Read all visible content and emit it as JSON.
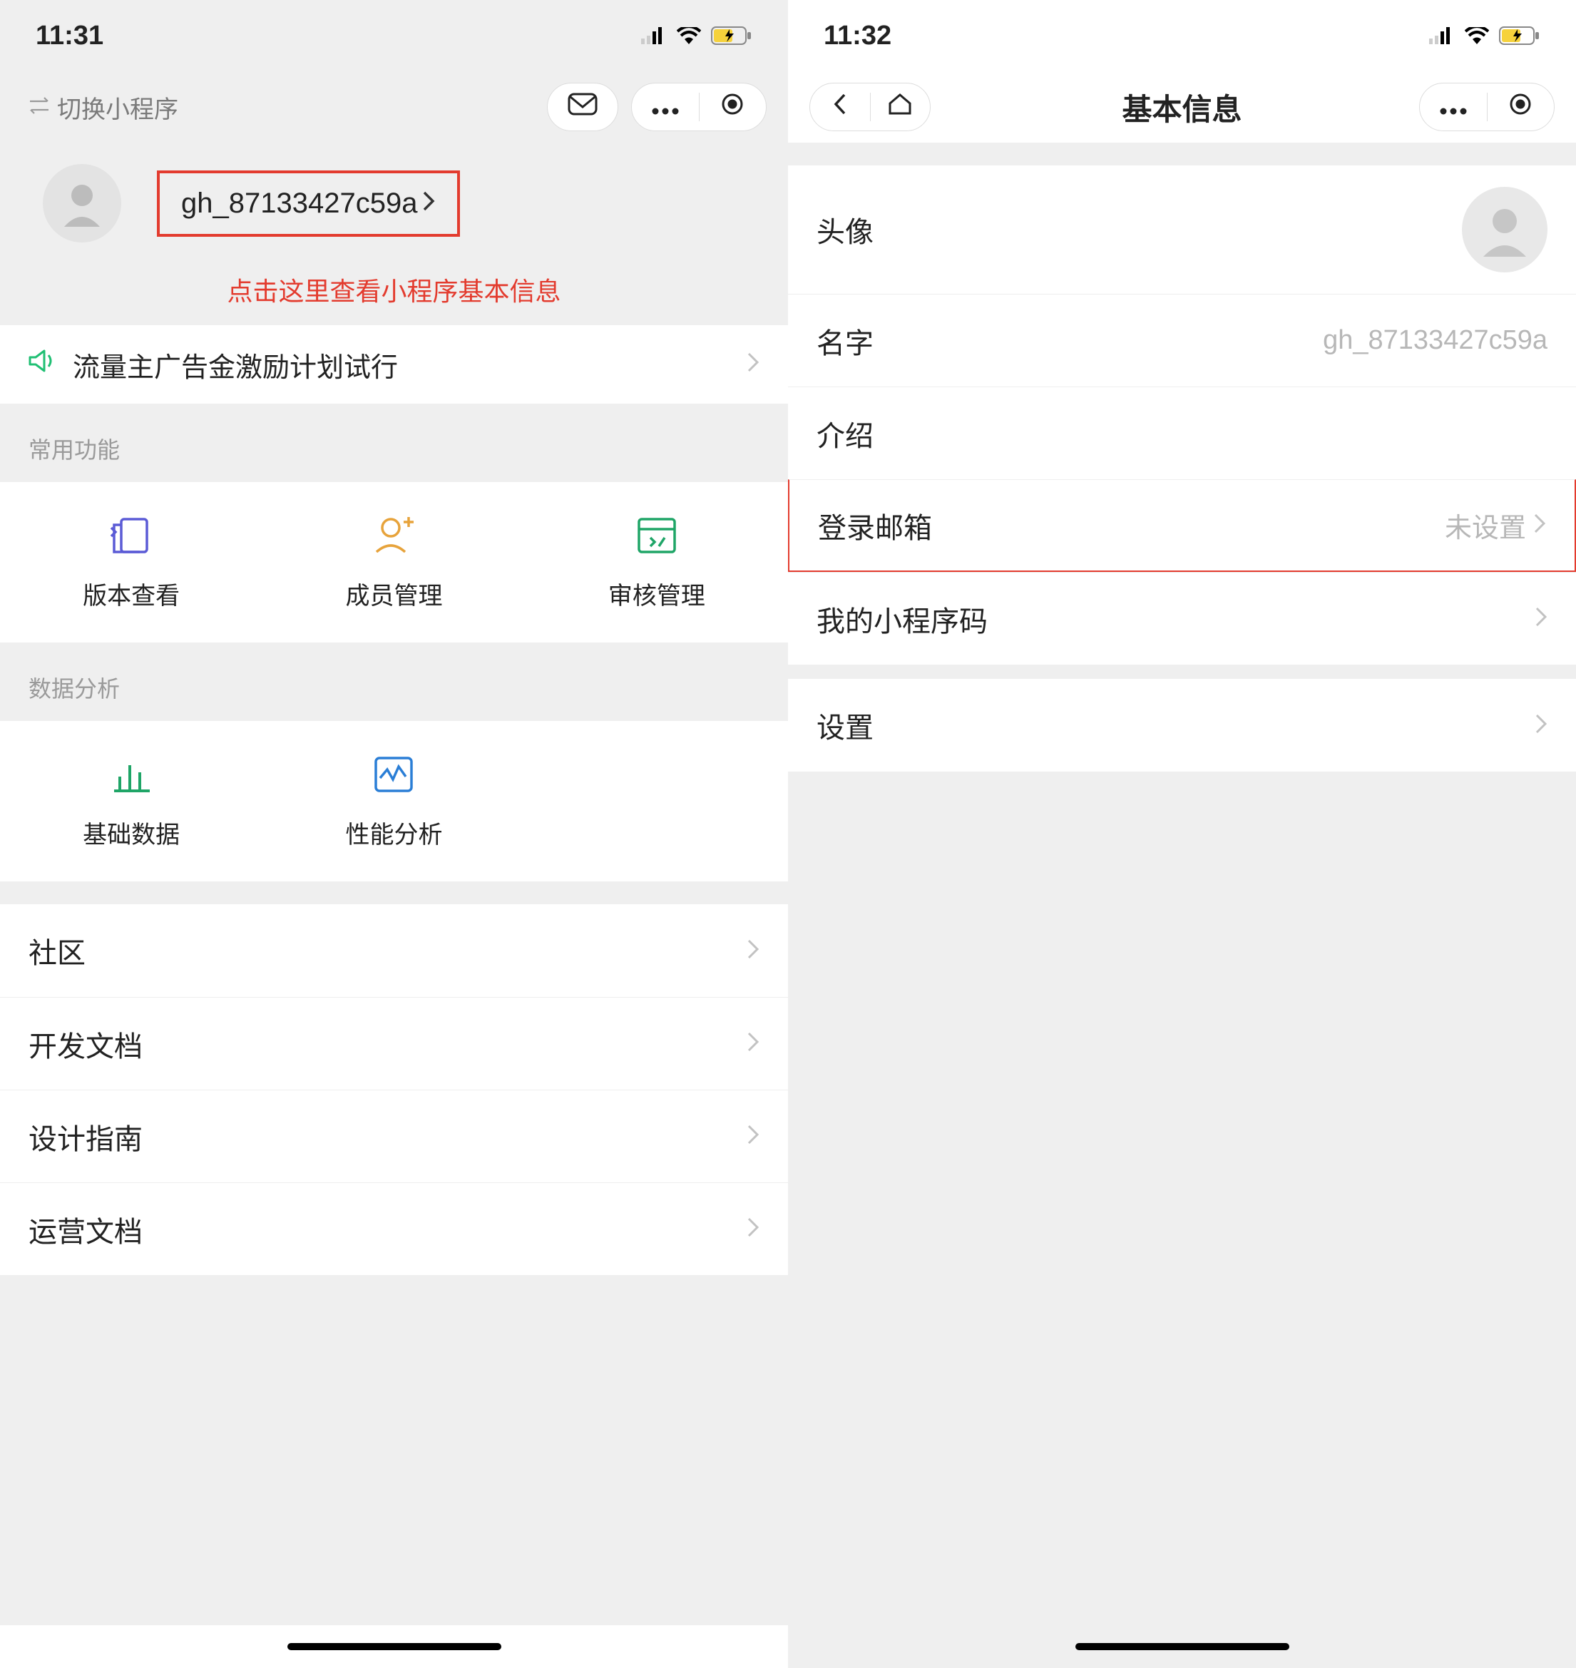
{
  "left": {
    "status_time": "11:31",
    "switch_label": "切换小程序",
    "profile_id": "gh_87133427c59a",
    "annotation": "点击这里查看小程序基本信息",
    "promo_label": "流量主广告金激励计划试行",
    "section_common": "常用功能",
    "features_common": [
      {
        "label": "版本查看"
      },
      {
        "label": "成员管理"
      },
      {
        "label": "审核管理"
      }
    ],
    "section_data": "数据分析",
    "features_data": [
      {
        "label": "基础数据"
      },
      {
        "label": "性能分析"
      }
    ],
    "links": [
      {
        "label": "社区"
      },
      {
        "label": "开发文档"
      },
      {
        "label": "设计指南"
      },
      {
        "label": "运营文档"
      }
    ]
  },
  "right": {
    "status_time": "11:32",
    "nav_title": "基本信息",
    "rows": {
      "avatar": "头像",
      "name_label": "名字",
      "name_value": "gh_87133427c59a",
      "intro": "介绍",
      "email_label": "登录邮箱",
      "email_value": "未设置",
      "qrcode": "我的小程序码",
      "settings": "设置"
    }
  }
}
